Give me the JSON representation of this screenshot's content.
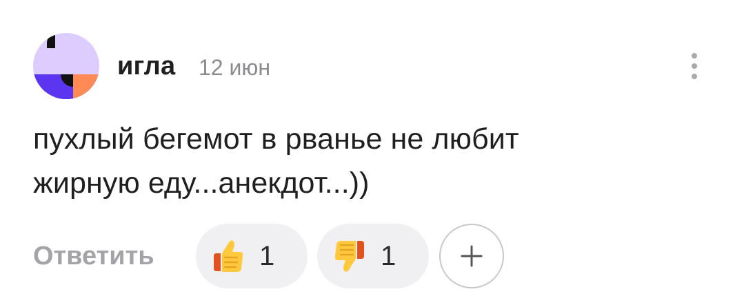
{
  "comment": {
    "author": "игла",
    "date": "12 июн",
    "text": "пухлый бегемот в рванье не любит\nжирную еду...анекдот...))",
    "more_icon": "more-vertical-icon",
    "reply_label": "Ответить",
    "reactions": [
      {
        "icon": "thumbs-up-icon",
        "count": "1"
      },
      {
        "icon": "thumbs-down-icon",
        "count": "1"
      }
    ],
    "add_reaction_icon": "plus-icon"
  },
  "colors": {
    "avatar_lavender": "#ddccff",
    "avatar_purple": "#5b35f0",
    "avatar_orange": "#ff8a55",
    "muted_text": "#8a8a8f",
    "pill_bg": "#f0f0f2"
  }
}
